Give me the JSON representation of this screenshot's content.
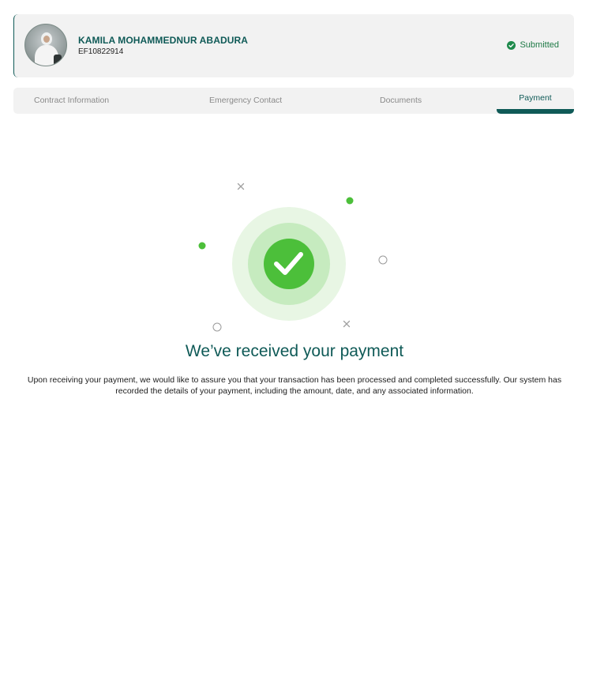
{
  "profile": {
    "name": "KAMILA MOHAMMEDNUR ABADURA",
    "id": "EF10822914",
    "status": "Submitted",
    "status_icon": "check-circle-icon",
    "avatar_icon": "user-photo"
  },
  "tabs": [
    {
      "label": "Contract Information",
      "active": false
    },
    {
      "label": "Emergency Contact",
      "active": false
    },
    {
      "label": "Documents",
      "active": false
    },
    {
      "label": "Payment",
      "active": true
    }
  ],
  "confirmation": {
    "title": "We’ve received your payment",
    "message": "Upon receiving your payment, we would like to assure you that your transaction has been processed and completed successfully. Our system has recorded the details of your payment, including the amount, date, and any associated information.",
    "icon": "check-icon"
  },
  "colors": {
    "primary": "#0f5a57",
    "success": "#4cbf3a",
    "status_text": "#1f7a46",
    "panel_bg": "#f2f2f2"
  }
}
